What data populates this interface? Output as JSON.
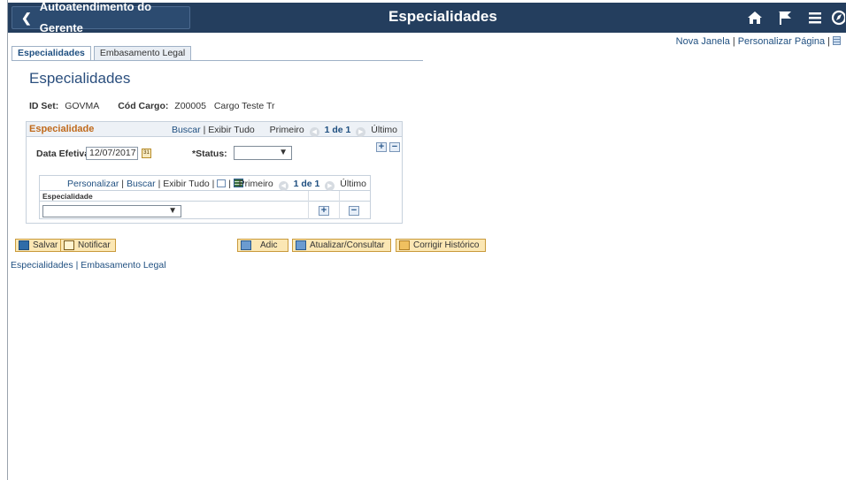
{
  "banner": {
    "back_label": "Autoatendimento do Gerente",
    "title": "Especialidades",
    "bg_color": "#243e5e",
    "icons": [
      "home-icon",
      "flag-icon",
      "menu-icon",
      "navigator-icon"
    ]
  },
  "top_links": {
    "new_window": "Nova Janela",
    "personalize": "Personalizar Página"
  },
  "tabs": [
    {
      "label": "Especialidades",
      "active": true
    },
    {
      "label": "Embasamento Legal",
      "active": false
    }
  ],
  "page": {
    "title": "Especialidades",
    "set_id_label": "ID Set:",
    "set_id_value": "GOVMA",
    "job_code_label": "Cód Cargo:",
    "job_code_value": "Z00005",
    "job_code_desc": "Cargo Teste Tr"
  },
  "section": {
    "title": "Especialidade",
    "find": "Buscar",
    "view_all": "Exibir Tudo",
    "first": "Primeiro",
    "counter": "1 de 1",
    "last": "Último",
    "eff_date_label": "Data Efetiva:",
    "eff_date_value": "12/07/2017",
    "status_label": "*Status:",
    "status_value": ""
  },
  "grid": {
    "personalize": "Personalizar",
    "find": "Buscar",
    "view_all": "Exibir Tudo",
    "first": "Primeiro",
    "counter": "1 de 1",
    "last": "Último",
    "column": "Especialidade",
    "row_value": ""
  },
  "toolbar": {
    "save": "Salvar",
    "notify": "Notificar",
    "add": "Adic",
    "update": "Atualizar/Consultar",
    "correct": "Corrigir Histórico"
  },
  "bottom_links": {
    "first": "Especialidades",
    "second": "Embasamento Legal"
  }
}
